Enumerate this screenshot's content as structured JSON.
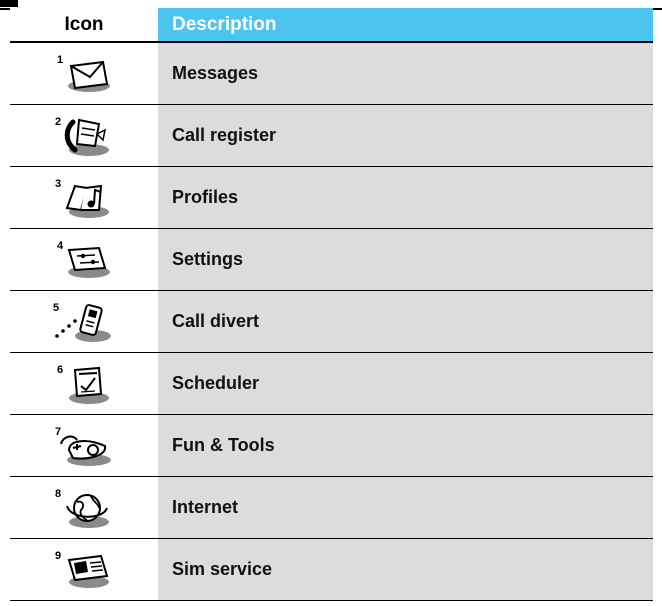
{
  "table": {
    "headers": {
      "icon": "Icon",
      "description": "Description"
    },
    "rows": [
      {
        "number": "1",
        "icon": "messages-icon",
        "label": "Messages"
      },
      {
        "number": "2",
        "icon": "call-register-icon",
        "label": "Call register"
      },
      {
        "number": "3",
        "icon": "profiles-icon",
        "label": "Profiles"
      },
      {
        "number": "4",
        "icon": "settings-icon",
        "label": "Settings"
      },
      {
        "number": "5",
        "icon": "call-divert-icon",
        "label": "Call divert"
      },
      {
        "number": "6",
        "icon": "scheduler-icon",
        "label": "Scheduler"
      },
      {
        "number": "7",
        "icon": "fun-tools-icon",
        "label": "Fun & Tools"
      },
      {
        "number": "8",
        "icon": "internet-icon",
        "label": "Internet"
      },
      {
        "number": "9",
        "icon": "sim-service-icon",
        "label": "Sim service"
      }
    ]
  },
  "colors": {
    "header_accent": "#4cc4f0",
    "row_shade": "#dcdcdc"
  }
}
